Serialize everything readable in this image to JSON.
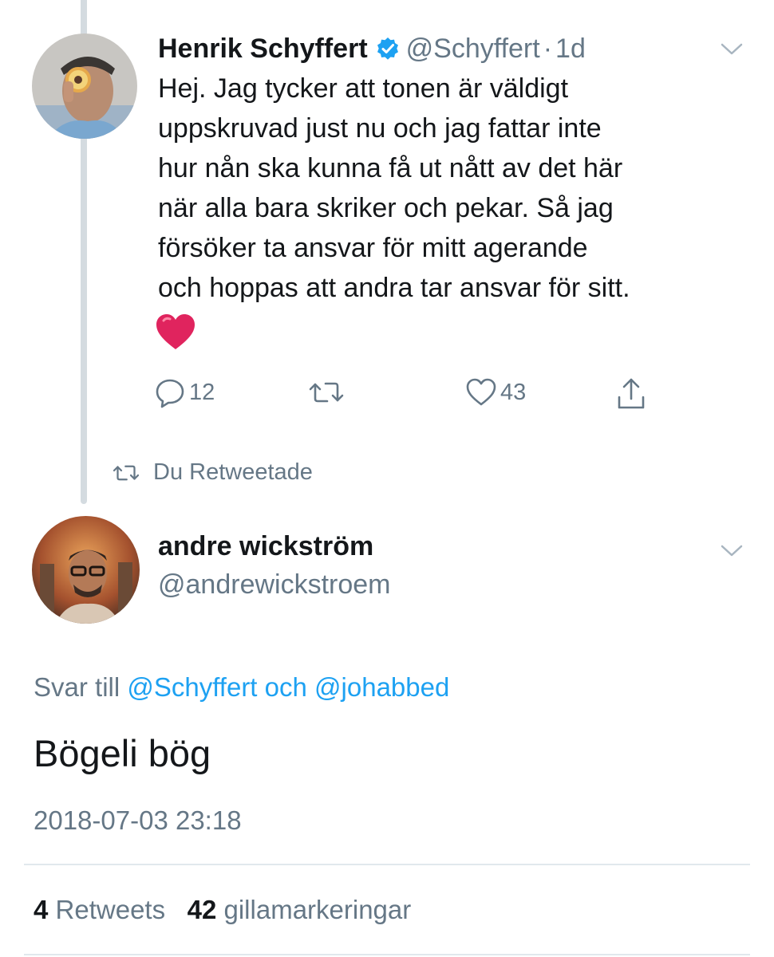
{
  "tweet1": {
    "name": "Henrik Schyffert",
    "handle": "@Schyffert",
    "separator": "·",
    "time": "1d",
    "lines": [
      "Hej. Jag tycker att tonen är väldigt",
      "uppskruvad just nu och jag fattar inte",
      "hur nån ska kunna få ut nått av det här",
      "när alla bara skriker och pekar. Så jag",
      "försöker ta ansvar för mitt agerande",
      "och hoppas att andra tar ansvar för sitt."
    ],
    "emoji": "red-heart-emoji",
    "reply_count": "12",
    "like_count": "43"
  },
  "retweet_note": "Du Retweetade",
  "tweet2": {
    "name": "andre wickström",
    "handle": "@andrewickstroem",
    "reply_prefix": "Svar till",
    "reply_mention1": "@Schyffert",
    "reply_joiner": "och",
    "reply_mention2": "@johabbed",
    "text": "Bögeli bög",
    "timestamp": "2018-07-03 23:18",
    "retweet_count": "4",
    "retweet_label": "Retweets",
    "like_count": "42",
    "like_label": "gillamarkeringar"
  },
  "colors": {
    "accent": "#1da1f2",
    "muted": "#657786",
    "text": "#14171a",
    "heart": "#e0245e"
  }
}
